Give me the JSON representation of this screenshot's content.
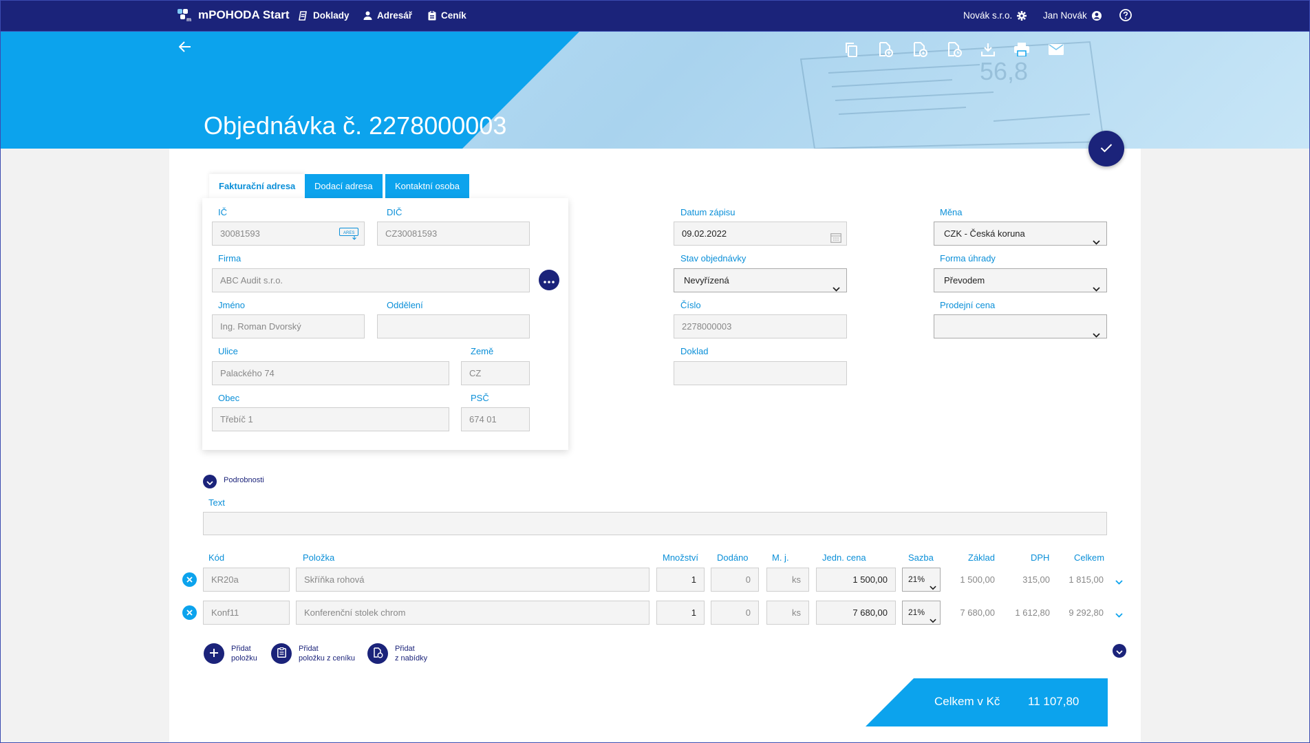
{
  "nav": {
    "app_name": "mPOHODA Start",
    "doklady": "Doklady",
    "adresar": "Adresář",
    "cenik": "Ceník",
    "company": "Novák s.r.o.",
    "user": "Jan Novák"
  },
  "hero": {
    "title": "Objednávka č. 2278000003"
  },
  "tabs": {
    "billing": "Fakturační adresa",
    "delivery": "Dodací adresa",
    "contact": "Kontaktní osoba"
  },
  "address": {
    "ic_label": "IČ",
    "ic_value": "30081593",
    "ares": "ARES",
    "dic_label": "DIČ",
    "dic_value": "CZ30081593",
    "firma_label": "Firma",
    "firma_value": "ABC Audit s.r.o.",
    "jmeno_label": "Jméno",
    "jmeno_value": "Ing. Roman Dvorský",
    "oddeleni_label": "Oddělení",
    "oddeleni_value": "",
    "ulice_label": "Ulice",
    "ulice_value": "Palackého 74",
    "zeme_label": "Země",
    "zeme_value": "CZ",
    "obec_label": "Obec",
    "obec_value": "Třebíč 1",
    "psc_label": "PSČ",
    "psc_value": "674 01"
  },
  "order": {
    "datum_label": "Datum zápisu",
    "datum_value": "09.02.2022",
    "stav_label": "Stav objednávky",
    "stav_value": "Nevyřízená",
    "cislo_label": "Číslo",
    "cislo_value": "2278000003",
    "doklad_label": "Doklad",
    "doklad_value": "",
    "mena_label": "Měna",
    "mena_value": "CZK - Česká koruna",
    "uhrada_label": "Forma úhrady",
    "uhrada_value": "Převodem",
    "cena_label": "Prodejní cena",
    "cena_value": ""
  },
  "details": {
    "toggle": "Podrobnosti",
    "text_label": "Text",
    "text_value": ""
  },
  "items": {
    "headers": {
      "kod": "Kód",
      "polozka": "Položka",
      "mnozstvi": "Množství",
      "dodano": "Dodáno",
      "mj": "M. j.",
      "cena": "Jedn. cena",
      "sazba": "Sazba",
      "zaklad": "Základ",
      "dph": "DPH",
      "celkem": "Celkem"
    },
    "rows": [
      {
        "kod": "KR20a",
        "polozka": "Skříňka rohová",
        "mnozstvi": "1",
        "dodano": "0",
        "mj": "ks",
        "cena": "1 500,00",
        "sazba": "21%",
        "zaklad": "1 500,00",
        "dph": "315,00",
        "celkem": "1 815,00"
      },
      {
        "kod": "Konf11",
        "polozka": "Konferenční stolek chrom",
        "mnozstvi": "1",
        "dodano": "0",
        "mj": "ks",
        "cena": "7 680,00",
        "sazba": "21%",
        "zaklad": "7 680,00",
        "dph": "1 612,80",
        "celkem": "9 292,80"
      }
    ]
  },
  "add": {
    "item_1": "Přidat",
    "item_2": "položku",
    "pricelist_1": "Přidat",
    "pricelist_2": "položku z ceníku",
    "offer_1": "Přidat",
    "offer_2": "z nabídky"
  },
  "total": {
    "label": "Celkem v Kč",
    "value": "11 107,80"
  },
  "colors": {
    "navy": "#1b237a",
    "accent": "#0ca3ed",
    "label_blue": "#0a8fd8"
  }
}
